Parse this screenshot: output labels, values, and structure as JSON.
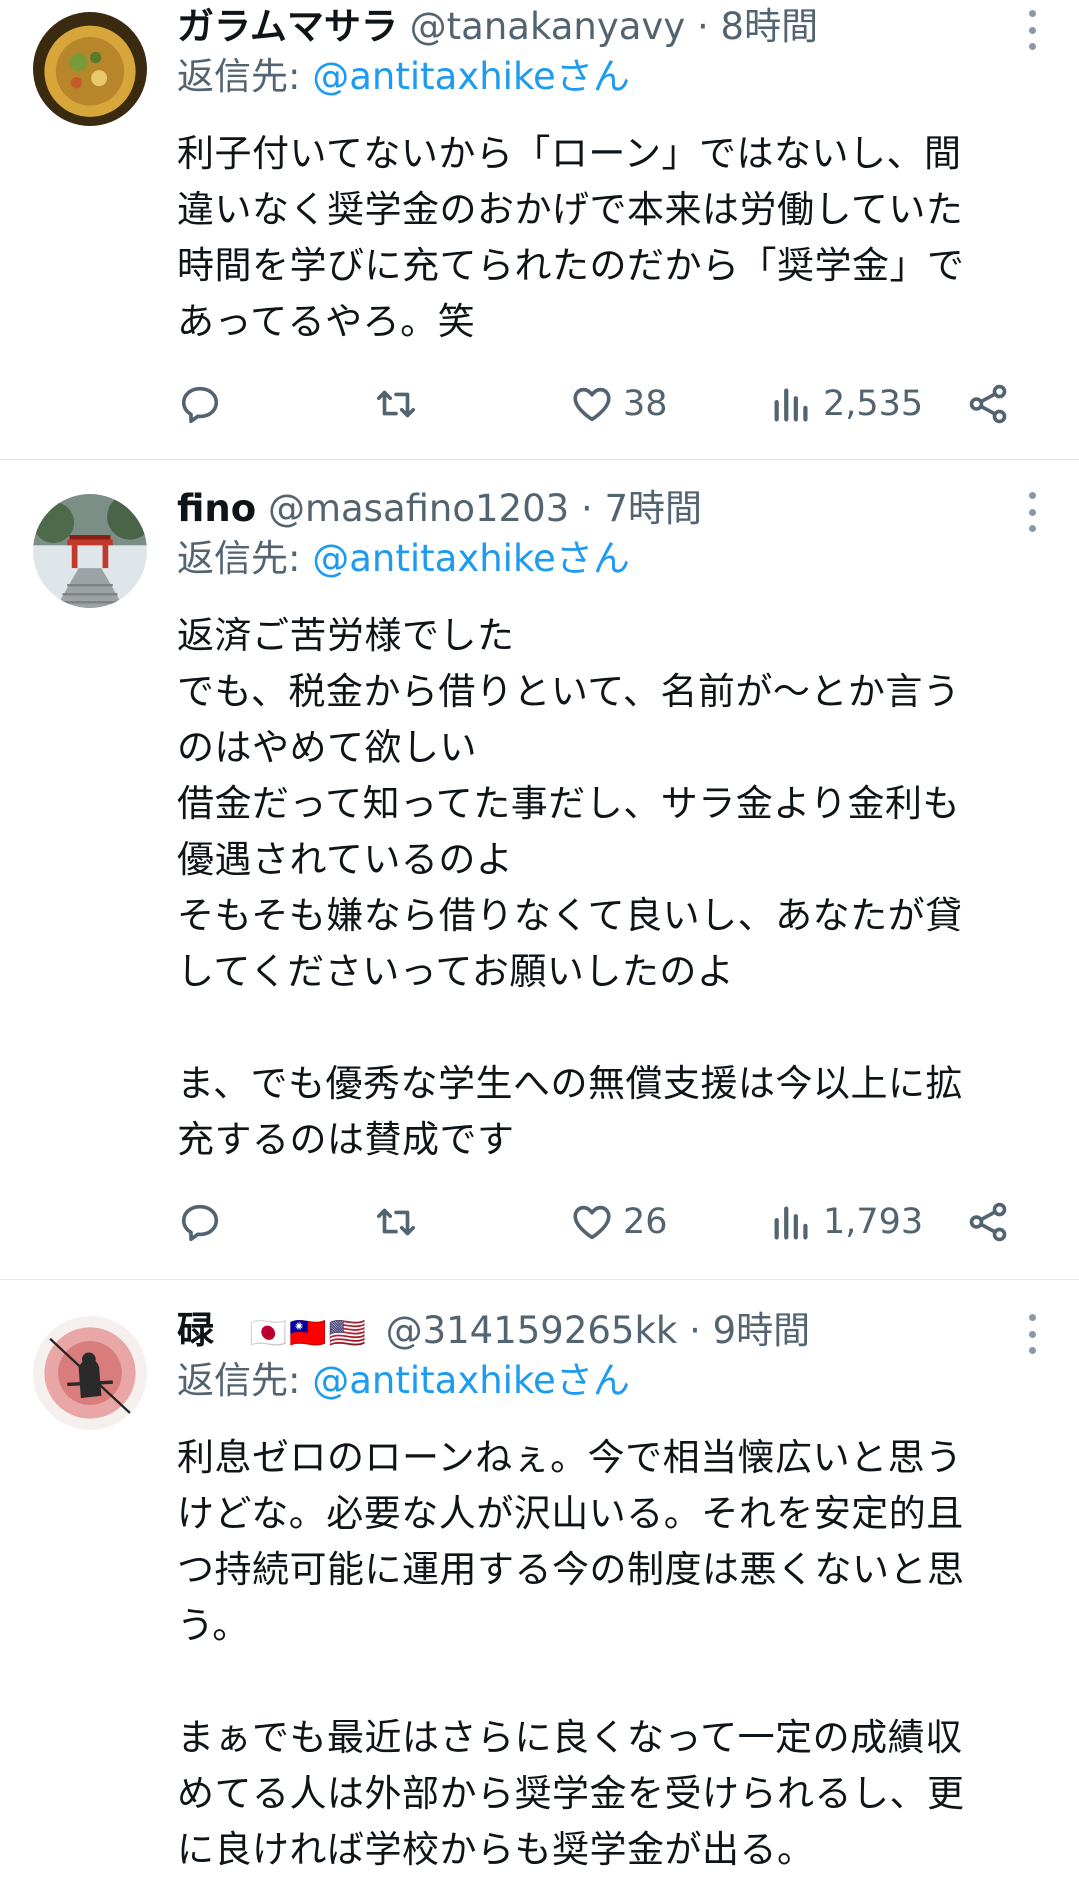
{
  "tweets": [
    {
      "display_name": "ガラムマサラ",
      "handle": "@tanakanyavy",
      "flags": "",
      "time": "8時間",
      "reply_prefix": "返信先: ",
      "reply_mention": "@antitaxhikeさん",
      "text": "利子付いてないから「ローン」ではないし、間\n違いなく奨学金のおかげで本来は労働していた\n時間を学びに充てられたのだから「奨学金」で\nあってるやろ。笑",
      "likes": "38",
      "views": "2,535"
    },
    {
      "display_name": "fino",
      "handle": "@masafino1203",
      "flags": "",
      "time": "7時間",
      "reply_prefix": "返信先: ",
      "reply_mention": "@antitaxhikeさん",
      "text": "返済ご苦労様でした\nでも、税金から借りといて、名前が〜とか言う\nのはやめて欲しい\n借金だって知ってた事だし、サラ金より金利も\n優遇されているのよ\nそもそも嫌なら借りなくて良いし、あなたが貸\nしてくださいってお願いしたのよ\n\nま、でも優秀な学生への無償支援は今以上に拡\n充するのは賛成です",
      "likes": "26",
      "views": "1,793"
    },
    {
      "display_name": "碌",
      "handle": "@314159265kk",
      "flags": "🇯🇵🇹🇼🇺🇸",
      "time": "9時間",
      "reply_prefix": "返信先: ",
      "reply_mention": "@antitaxhikeさん",
      "text": "利息ゼロのローンねぇ。今で相当懐広いと思う\nけどな。必要な人が沢山いる。それを安定的且\nつ持続可能に運用する今の制度は悪くないと思\nう。\n\nまぁでも最近はさらに良くなって一定の成績収\nめてる人は外部から奨学金を受けられるし、更\nに良ければ学校からも奨学金が出る。"
    }
  ],
  "separator": " · ",
  "icons": {
    "reply": "reply-icon",
    "retweet": "retweet-icon",
    "like": "heart-icon",
    "views": "views-icon",
    "share": "share-icon",
    "more": "more-vertical-icon"
  },
  "colors": {
    "link": "#1d9bf0",
    "secondary": "#536471",
    "text": "#0f1419"
  }
}
